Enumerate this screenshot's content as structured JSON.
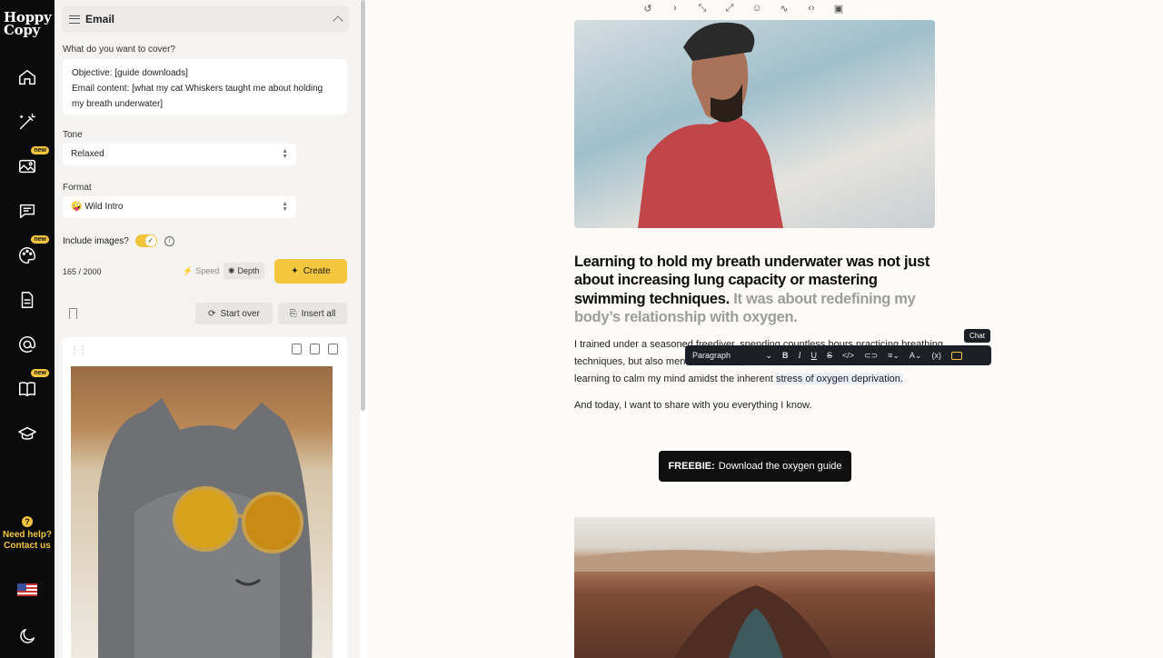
{
  "brand": {
    "logo_line1": "Hoppy",
    "logo_line2": "Copy"
  },
  "nav": {
    "items": [
      {
        "name": "home-icon",
        "new": false
      },
      {
        "name": "magic-wand-icon",
        "new": false
      },
      {
        "name": "image-icon",
        "new": true
      },
      {
        "name": "chat-icon",
        "new": false
      },
      {
        "name": "palette-icon",
        "new": true
      },
      {
        "name": "document-icon",
        "new": false
      },
      {
        "name": "at-sign-icon",
        "new": false
      },
      {
        "name": "book-icon",
        "new": true
      },
      {
        "name": "graduation-cap-icon",
        "new": false
      }
    ],
    "new_label": "new",
    "help_line1": "Need help?",
    "help_line2": "Contact us"
  },
  "panel": {
    "title": "Email",
    "cover_label": "What do you want to cover?",
    "cover_text_1": "Objective: [guide downloads]",
    "cover_text_2": "Email content: [what my cat Whiskers taught me about holding",
    "cover_text_3": "my breath underwater]",
    "tone_label": "Tone",
    "tone_value": "Relaxed",
    "format_label": "Format",
    "format_emoji": "🤪",
    "format_value": "Wild Intro",
    "include_images_label": "Include images?",
    "include_images": true,
    "char_count": "165 / 2000",
    "speed_label": "Speed",
    "depth_label": "Depth",
    "create_label": "Create",
    "start_over_label": "Start over",
    "insert_all_label": "Insert all"
  },
  "editor": {
    "heading_main": "Learning to hold my breath underwater was not just about increasing lung capacity or mastering swimming techniques.",
    "heading_faded": " It was about redefining my body’s relationship with oxygen.",
    "para1_start": "I trained under a seasoned freediver, spending countless hours practicing breathing techniques, but also",
    "para1_mid": " mental exercises, ",
    "para1_line3_pre": "learning to calm my mind amidst the inherent ",
    "para1_line3_hl": "stress of oxygen deprivation.",
    "para2": "And today, I want to share with you everything I know.",
    "freebie_bold": "FREEBIE:",
    "freebie_text": "Download the oxygen guide",
    "bubble_style": "Paragraph",
    "chat_tooltip": "Chat"
  },
  "colors": {
    "accent": "#f4c63d",
    "nav_bg": "#0b0b0b",
    "panel_bg": "#f4f3f1",
    "editor_bg": "#fcfbf8"
  }
}
